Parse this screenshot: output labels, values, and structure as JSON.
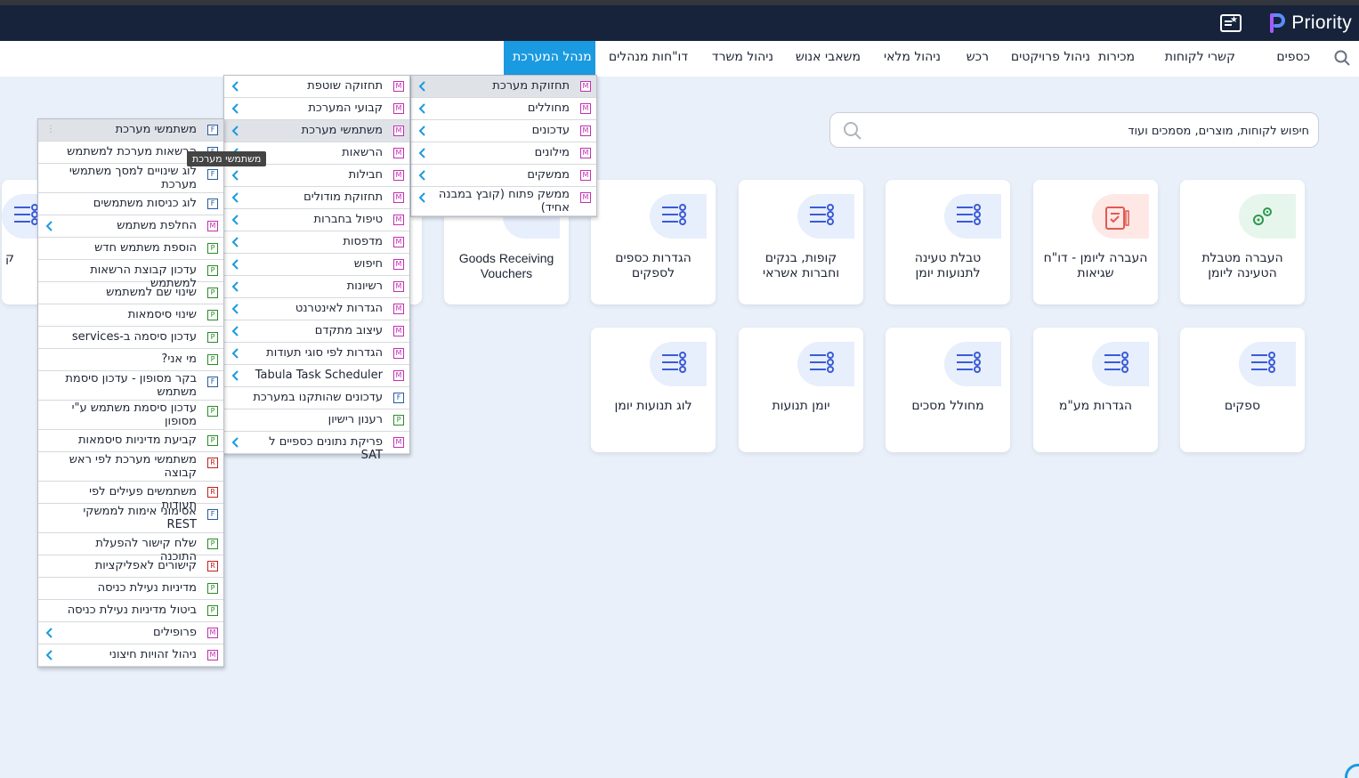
{
  "brand": {
    "name": "Priority"
  },
  "nav": {
    "items": [
      "כספים",
      "קשרי לקוחות",
      "מכירות",
      "ניהול פרויקטים",
      "רכש",
      "ניהול מלאי",
      "משאבי אנוש",
      "ניהול משרד",
      "דו\"חות מנהלים",
      "מנהל המערכת"
    ],
    "active": "מנהל המערכת"
  },
  "search": {
    "placeholder": "חיפוש לקוחות, מוצרים, מסמכים ועוד"
  },
  "tiles": [
    {
      "label": "העברה מטבלת הטעינה ליומן",
      "icon": "gears-icon",
      "tone": "green"
    },
    {
      "label": "העברה ליומן - דו\"ח שגיאות",
      "icon": "report-icon",
      "tone": "pink"
    },
    {
      "label": "טבלת טעינה לתנועות יומן",
      "icon": "list-icon",
      "tone": "blue"
    },
    {
      "label": "קופות, בנקים וחברות אשראי",
      "icon": "list-icon",
      "tone": "blue"
    },
    {
      "label": "הגדרות כספים לספקים",
      "icon": "list-icon",
      "tone": "blue"
    },
    {
      "label": "Goods Receiving Vouchers",
      "icon": "list-icon",
      "tone": "blue"
    },
    {
      "label": "ספקים",
      "icon": "list-icon",
      "tone": "blue"
    },
    {
      "label": "הגדרות מע\"מ",
      "icon": "list-icon",
      "tone": "blue"
    },
    {
      "label": "מחולל מסכים",
      "icon": "list-icon",
      "tone": "blue"
    },
    {
      "label": "יומן תנועות",
      "icon": "list-icon",
      "tone": "blue"
    },
    {
      "label": "לוג תנועות יומן",
      "icon": "list-icon",
      "tone": "blue"
    },
    {
      "label": "ק",
      "icon": "list-icon",
      "tone": "blue"
    }
  ],
  "menu1": {
    "items": [
      {
        "badge": "M",
        "label": "תחזוקת מערכת",
        "arrow": true
      },
      {
        "badge": "M",
        "label": "מחוללים",
        "arrow": true
      },
      {
        "badge": "M",
        "label": "עדכונים",
        "arrow": true
      },
      {
        "badge": "M",
        "label": "מילונים",
        "arrow": true
      },
      {
        "badge": "M",
        "label": "ממשקים",
        "arrow": true
      },
      {
        "badge": "M",
        "label": "ממשק פתוח (קובץ במבנה אחיד)",
        "arrow": true
      }
    ]
  },
  "menu2": {
    "items": [
      {
        "badge": "M",
        "label": "תחזוקה שוטפת",
        "arrow": true
      },
      {
        "badge": "M",
        "label": "קבועי המערכת",
        "arrow": true
      },
      {
        "badge": "M",
        "label": "משתמשי מערכת",
        "arrow": true
      },
      {
        "badge": "M",
        "label": "הרשאות",
        "arrow": true
      },
      {
        "badge": "M",
        "label": "חבילות",
        "arrow": true
      },
      {
        "badge": "M",
        "label": "תחזוקת מודולים",
        "arrow": true
      },
      {
        "badge": "M",
        "label": "טיפול בחברות",
        "arrow": true
      },
      {
        "badge": "M",
        "label": "מדפסות",
        "arrow": true
      },
      {
        "badge": "M",
        "label": "חיפוש",
        "arrow": true
      },
      {
        "badge": "M",
        "label": "רשיונות",
        "arrow": true
      },
      {
        "badge": "M",
        "label": "הגדרות לאינטרנט",
        "arrow": true
      },
      {
        "badge": "M",
        "label": "עיצוב מתקדם",
        "arrow": true
      },
      {
        "badge": "M",
        "label": "הגדרות לפי סוגי תעודות",
        "arrow": true
      },
      {
        "badge": "M",
        "label": "Tabula Task Scheduler",
        "arrow": true
      },
      {
        "badge": "F",
        "label": "עדכונים שהותקנו במערכת",
        "arrow": false
      },
      {
        "badge": "P",
        "label": "רענון רישיון",
        "arrow": false
      },
      {
        "badge": "M",
        "label": "פריקת נתונים כספיים ל SAT",
        "arrow": true
      }
    ]
  },
  "menu3": {
    "items": [
      {
        "badge": "F",
        "label": "משתמשי מערכת",
        "arrow": false
      },
      {
        "badge": "F",
        "label": "הרשאות מערכת למשתמש",
        "arrow": false
      },
      {
        "badge": "F",
        "label": "לוג שינויים למסך משתמשי מערכת",
        "arrow": false
      },
      {
        "badge": "F",
        "label": "לוג כניסות משתמשים",
        "arrow": false
      },
      {
        "badge": "M",
        "label": "החלפת משתמש",
        "arrow": true
      },
      {
        "badge": "P",
        "label": "הוספת משתמש חדש",
        "arrow": false
      },
      {
        "badge": "P",
        "label": "עדכון קבוצת הרשאות למשתמש",
        "arrow": false
      },
      {
        "badge": "P",
        "label": "שינוי שם למשתמש",
        "arrow": false
      },
      {
        "badge": "P",
        "label": "שינוי סיסמאות",
        "arrow": false
      },
      {
        "badge": "P",
        "label": "עדכון סיסמה ב-services",
        "arrow": false
      },
      {
        "badge": "P",
        "label": "מי אני?",
        "arrow": false
      },
      {
        "badge": "F",
        "label": "בקר מסופון - עדכון סיסמת משתמש",
        "arrow": false
      },
      {
        "badge": "P",
        "label": "עדכון סיסמת משתמש ע\"י מסופון",
        "arrow": false
      },
      {
        "badge": "P",
        "label": "קביעת מדיניות סיסמאות",
        "arrow": false
      },
      {
        "badge": "R",
        "label": "משתמשי מערכת לפי ראש קבוצה",
        "arrow": false
      },
      {
        "badge": "R",
        "label": "משתמשים פעילים לפי תעודות",
        "arrow": false
      },
      {
        "badge": "F",
        "label": "אסימוני אימות לממשקי REST",
        "arrow": false
      },
      {
        "badge": "P",
        "label": "שלח קישור להפעלת התוכנה",
        "arrow": false
      },
      {
        "badge": "R",
        "label": "קישורים לאפליקציות",
        "arrow": false
      },
      {
        "badge": "P",
        "label": "מדיניות נעילת כניסה",
        "arrow": false
      },
      {
        "badge": "P",
        "label": "ביטול מדיניות נעילת כניסה",
        "arrow": false
      },
      {
        "badge": "M",
        "label": "פרופילים",
        "arrow": true
      },
      {
        "badge": "M",
        "label": "ניהול זהויות חיצוני",
        "arrow": true
      }
    ]
  },
  "tooltip": "משתמשי מערכת"
}
